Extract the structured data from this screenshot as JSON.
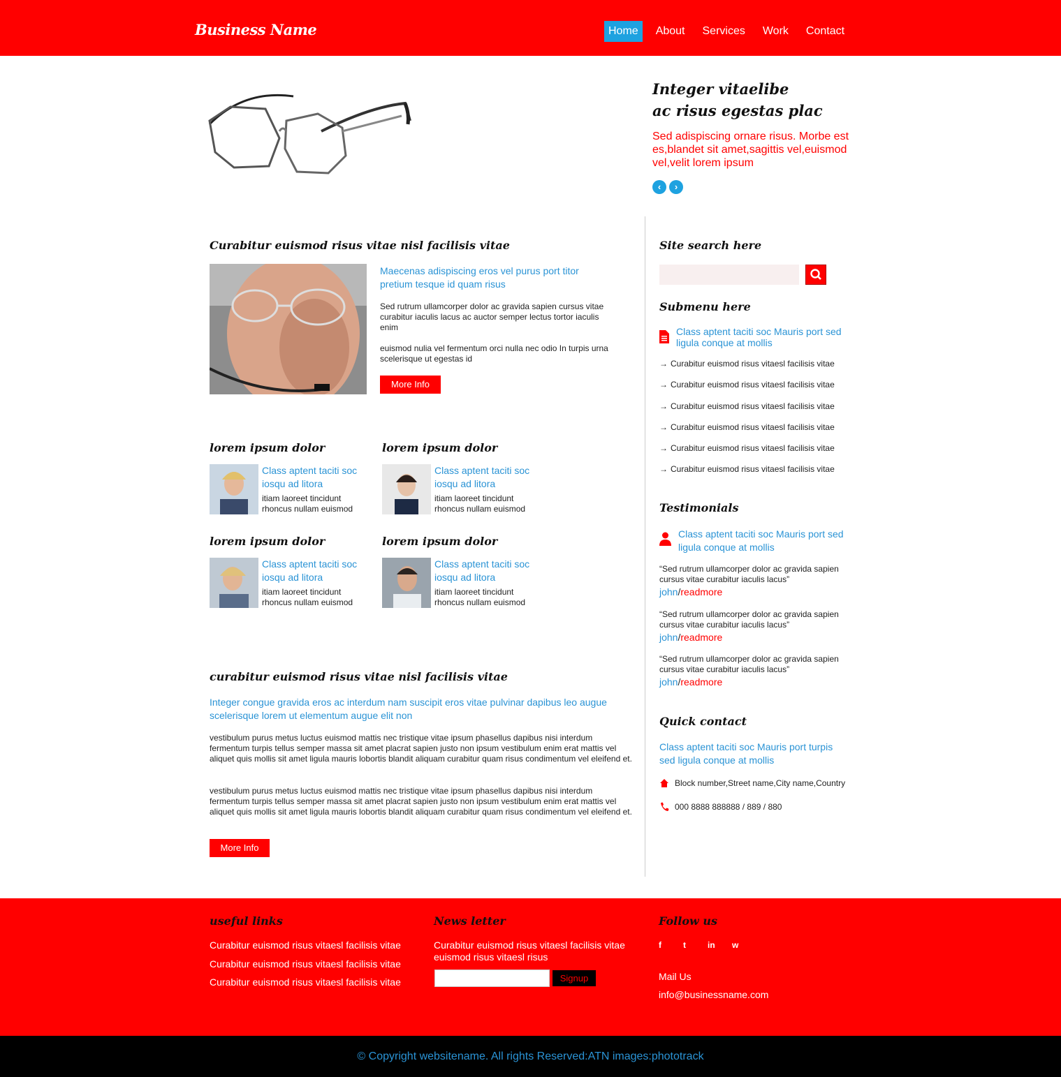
{
  "header": {
    "brand": "Business Name",
    "nav": [
      "Home",
      "About",
      "Services",
      "Work",
      "Contact"
    ]
  },
  "hero": {
    "title_line1": "Integer vitaelibe",
    "title_line2": "ac risus egestas plac",
    "text": "Sed adispiscing ornare risus. Morbe est es,blandet sit amet,sagittis vel,euismod vel,velit lorem ipsum",
    "prev_icon": "chevron-left-icon",
    "next_icon": "chevron-right-icon"
  },
  "section1": {
    "title": "Curabitur euismod risus vitae nisl facilisis vitae",
    "lead": "Maecenas adispiscing eros vel purus port titor pretium tesque id quam risus",
    "p1": "Sed rutrum ullamcorper dolor ac gravida sapien cursus vitae curabitur iaculis lacus ac auctor semper lectus tortor iaculis enim",
    "p2": "euismod nulia vel fermentum orci nulla nec odio In turpis urna scelerisque ut egestas id",
    "button": "More Info"
  },
  "cards": [
    {
      "title": "lorem ipsum dolor",
      "lead": "Class aptent taciti soc iosqu ad litora",
      "sub": "itiam laoreet tincidunt rhoncus nullam euismod"
    },
    {
      "title": "lorem ipsum dolor",
      "lead": "Class aptent taciti soc iosqu ad litora",
      "sub": "itiam laoreet tincidunt rhoncus nullam euismod"
    },
    {
      "title": "lorem ipsum dolor",
      "lead": "Class aptent taciti soc iosqu ad litora",
      "sub": "itiam laoreet tincidunt rhoncus nullam euismod"
    },
    {
      "title": "lorem ipsum dolor",
      "lead": "Class aptent taciti soc iosqu ad litora",
      "sub": "itiam laoreet tincidunt rhoncus nullam euismod"
    }
  ],
  "section3": {
    "title": "curabitur euismod risus vitae nisl facilisis vitae",
    "lead": "Integer congue gravida eros ac interdum nam suscipit eros vitae pulvinar dapibus leo augue scelerisque lorem ut elementum augue elit non",
    "p1": "vestibulum purus metus luctus euismod mattis nec tristique vitae ipsum phasellus dapibus nisi interdum fermentum turpis tellus semper massa sit amet placrat sapien justo non ipsum vestibulum enim erat mattis vel aliquet quis mollis sit amet ligula mauris lobortis blandit aliquam curabitur quam risus condimentum vel eleifend et.",
    "p2": "vestibulum purus metus luctus euismod mattis nec tristique vitae ipsum phasellus dapibus nisi interdum fermentum turpis tellus semper massa sit amet placrat sapien justo non ipsum vestibulum enim erat mattis vel aliquet quis mollis sit amet ligula mauris lobortis blandit aliquam curabitur quam risus condimentum vel eleifend et.",
    "button": "More Info"
  },
  "sidebar": {
    "search_title": "Site search here",
    "search_placeholder": "",
    "search_icon": "search-icon",
    "submenu_title": "Submenu here",
    "submenu_lead": "Class aptent taciti soc Mauris port sed ligula conque at mollis",
    "submenu_items": [
      "Curabitur euismod risus vitaesl facilisis vitae",
      "Curabitur euismod risus vitaesl facilisis vitae",
      "Curabitur euismod risus vitaesl facilisis vitae",
      "Curabitur euismod risus vitaesl facilisis vitae",
      "Curabitur euismod risus vitaesl facilisis vitae",
      "Curabitur euismod risus vitaesl facilisis vitae"
    ],
    "testimonials_title": "Testimonials",
    "testimonials_lead": "Class aptent taciti soc Mauris port sed ligula conque at mollis",
    "testimonials": [
      {
        "quote": "“Sed rutrum ullamcorper dolor ac gravida sapien cursus vitae curabitur iaculis lacus”",
        "name": "john",
        "sep": "/",
        "more": "readmore"
      },
      {
        "quote": "“Sed rutrum ullamcorper dolor ac gravida sapien cursus vitae curabitur iaculis lacus”",
        "name": "john",
        "sep": "/",
        "more": "readmore"
      },
      {
        "quote": "“Sed rutrum ullamcorper dolor ac gravida sapien cursus vitae curabitur iaculis lacus”",
        "name": "john",
        "sep": "/",
        "more": "readmore"
      }
    ],
    "quick_title": "Quick contact",
    "quick_lead": "Class aptent taciti soc Mauris port turpis sed ligula conque at mollis",
    "address": "Block number,Street name,City name,Country",
    "phone": "000 8888 888888 / 889 / 880"
  },
  "footer": {
    "links_title": "useful links",
    "links": [
      "Curabitur euismod risus vitaesl facilisis vitae",
      "Curabitur euismod risus vitaesl facilisis vitae",
      "Curabitur euismod risus vitaesl facilisis vitae"
    ],
    "news_title": "News letter",
    "news_text": "Curabitur euismod risus vitaesl facilisis vitae euismod risus vitaesl risus",
    "signup": "Signup",
    "follow_title": "Follow us",
    "social": [
      "f",
      "t",
      "in",
      "w"
    ],
    "mail_label": "Mail Us",
    "mail": "info@businessname.com"
  },
  "copyright": "© Copyright websitename. All rights Reserved:ATN images:phototrack",
  "colors": {
    "brand_red": "#ff0000",
    "accent_blue": "#1ea2e0",
    "link_blue": "#2a93d5",
    "copyright_bg": "#000000"
  }
}
